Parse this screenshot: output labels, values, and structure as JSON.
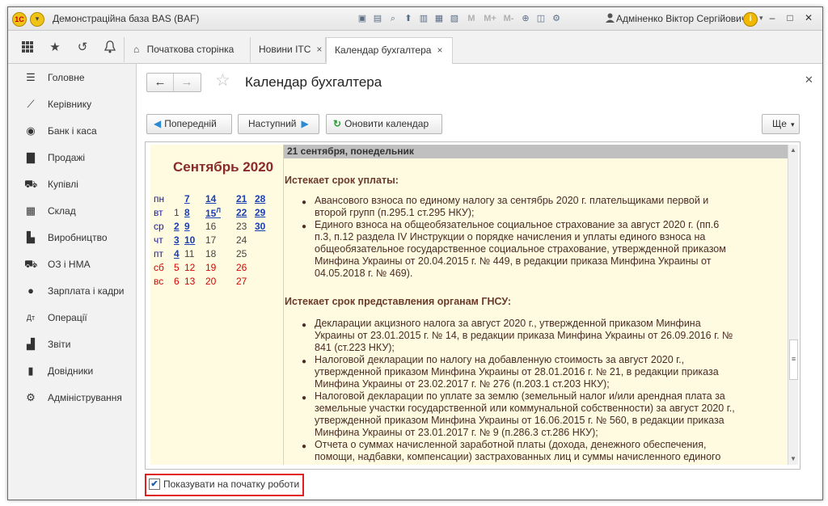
{
  "window": {
    "title": "Демонстраційна база BAS  (BAF)",
    "user": "Адміненко Віктор Сергійович",
    "toolbar_m": [
      "M",
      "M+",
      "M-"
    ]
  },
  "tabs": [
    {
      "label": "Початкова сторінка"
    },
    {
      "label": "Новини ІТС",
      "close": "×"
    },
    {
      "label": "Календар бухгалтера",
      "close": "×"
    }
  ],
  "sidebar": {
    "items": [
      {
        "label": "Головне",
        "icon": "menu-icon"
      },
      {
        "label": "Керівнику",
        "icon": "trend-icon"
      },
      {
        "label": "Банк і каса",
        "icon": "coins-icon"
      },
      {
        "label": "Продажі",
        "icon": "bag-icon"
      },
      {
        "label": "Купівлі",
        "icon": "cart-icon"
      },
      {
        "label": "Склад",
        "icon": "grid-icon"
      },
      {
        "label": "Виробництво",
        "icon": "factory-icon"
      },
      {
        "label": "ОЗ і НМА",
        "icon": "truck-icon"
      },
      {
        "label": "Зарплата і кадри",
        "icon": "person-icon"
      },
      {
        "label": "Операції",
        "icon": "dtkt-icon"
      },
      {
        "label": "Звіти",
        "icon": "barchart-icon"
      },
      {
        "label": "Довідники",
        "icon": "books-icon"
      },
      {
        "label": "Адміністрування",
        "icon": "gear-icon"
      }
    ]
  },
  "form": {
    "title": "Календар бухгалтера",
    "buttons": {
      "prev": "Попередній",
      "next": "Наступний",
      "refresh": "Оновити календар",
      "more": "Ще"
    },
    "show_on_start": "Показувати на початку роботи",
    "show_on_start_checked": true
  },
  "calendar": {
    "month": "Сентябрь 2020",
    "rows": [
      {
        "day": "пн",
        "cells": [
          "",
          "7",
          "14",
          "21",
          "28"
        ]
      },
      {
        "day": "вт",
        "cells": [
          "1",
          "8",
          "15Л",
          "22",
          "29"
        ]
      },
      {
        "day": "ср",
        "cells": [
          "2",
          "9",
          "16",
          "23",
          "30"
        ]
      },
      {
        "day": "чт",
        "cells": [
          "3",
          "10",
          "17",
          "24",
          ""
        ]
      },
      {
        "day": "пт",
        "cells": [
          "4",
          "11",
          "18",
          "25",
          ""
        ]
      },
      {
        "day": "сб",
        "cells": [
          "5",
          "12",
          "19",
          "26",
          ""
        ]
      },
      {
        "day": "вс",
        "cells": [
          "6",
          "13",
          "20",
          "27",
          ""
        ]
      }
    ]
  },
  "info": {
    "date_header": "21 сентября, понедельник",
    "section1": "Истекает срок уплаты:",
    "s1_items": [
      [
        "Авансового взноса по единому налогу за сентябрь 2020 г. плательщиками первой и",
        "второй групп (п.295.1 ст.295 НКУ);"
      ],
      [
        "Единого взноса на общеобязательное социальное страхование за август 2020 г. (пп.6",
        "п.3, п.12 раздела IV Инструкции о порядке начисления и уплаты единого взноса на",
        "общеобязательное государственное социальное страхование, утвержденной приказом",
        "Минфина Украины от 20.04.2015 г. № 449, в редакции приказа Минфина Украины от",
        "04.05.2018 г. № 469)."
      ]
    ],
    "section2": "Истекает срок представления органам ГНСУ:",
    "s2_items": [
      [
        "Декларации акцизного налога за август 2020 г., утвержденной приказом Минфина",
        "Украины от 23.01.2015 г. № 14, в редакции приказа Минфина Украины от 26.09.2016 г. №",
        "841 (ст.223 НКУ);"
      ],
      [
        "Налоговой декларации по налогу на добавленную стоимость за август 2020 г.,",
        "утвержденной приказом Минфина Украины от 28.01.2016 г. № 21, в редакции приказа",
        "Минфина Украины от 23.02.2017 г. № 276 (п.203.1 ст.203 НКУ);"
      ],
      [
        "Налоговой декларации по уплате за землю (земельный налог и/или арендная плата за",
        "земельные участки государственной или коммунальной собственности) за август 2020 г.,",
        "утвержденной приказом Минфина Украины от 16.06.2015 г. № 560, в редакции приказа",
        "Минфина Украины от 23.01.2017 г. № 9 (п.286.3 ст.286 НКУ);"
      ],
      [
        "Отчета о суммах начисленной заработной платы (дохода, денежного обеспечения,",
        "помощи, надбавки, компенсации) застрахованных лиц и суммы начисленного единого"
      ]
    ]
  }
}
